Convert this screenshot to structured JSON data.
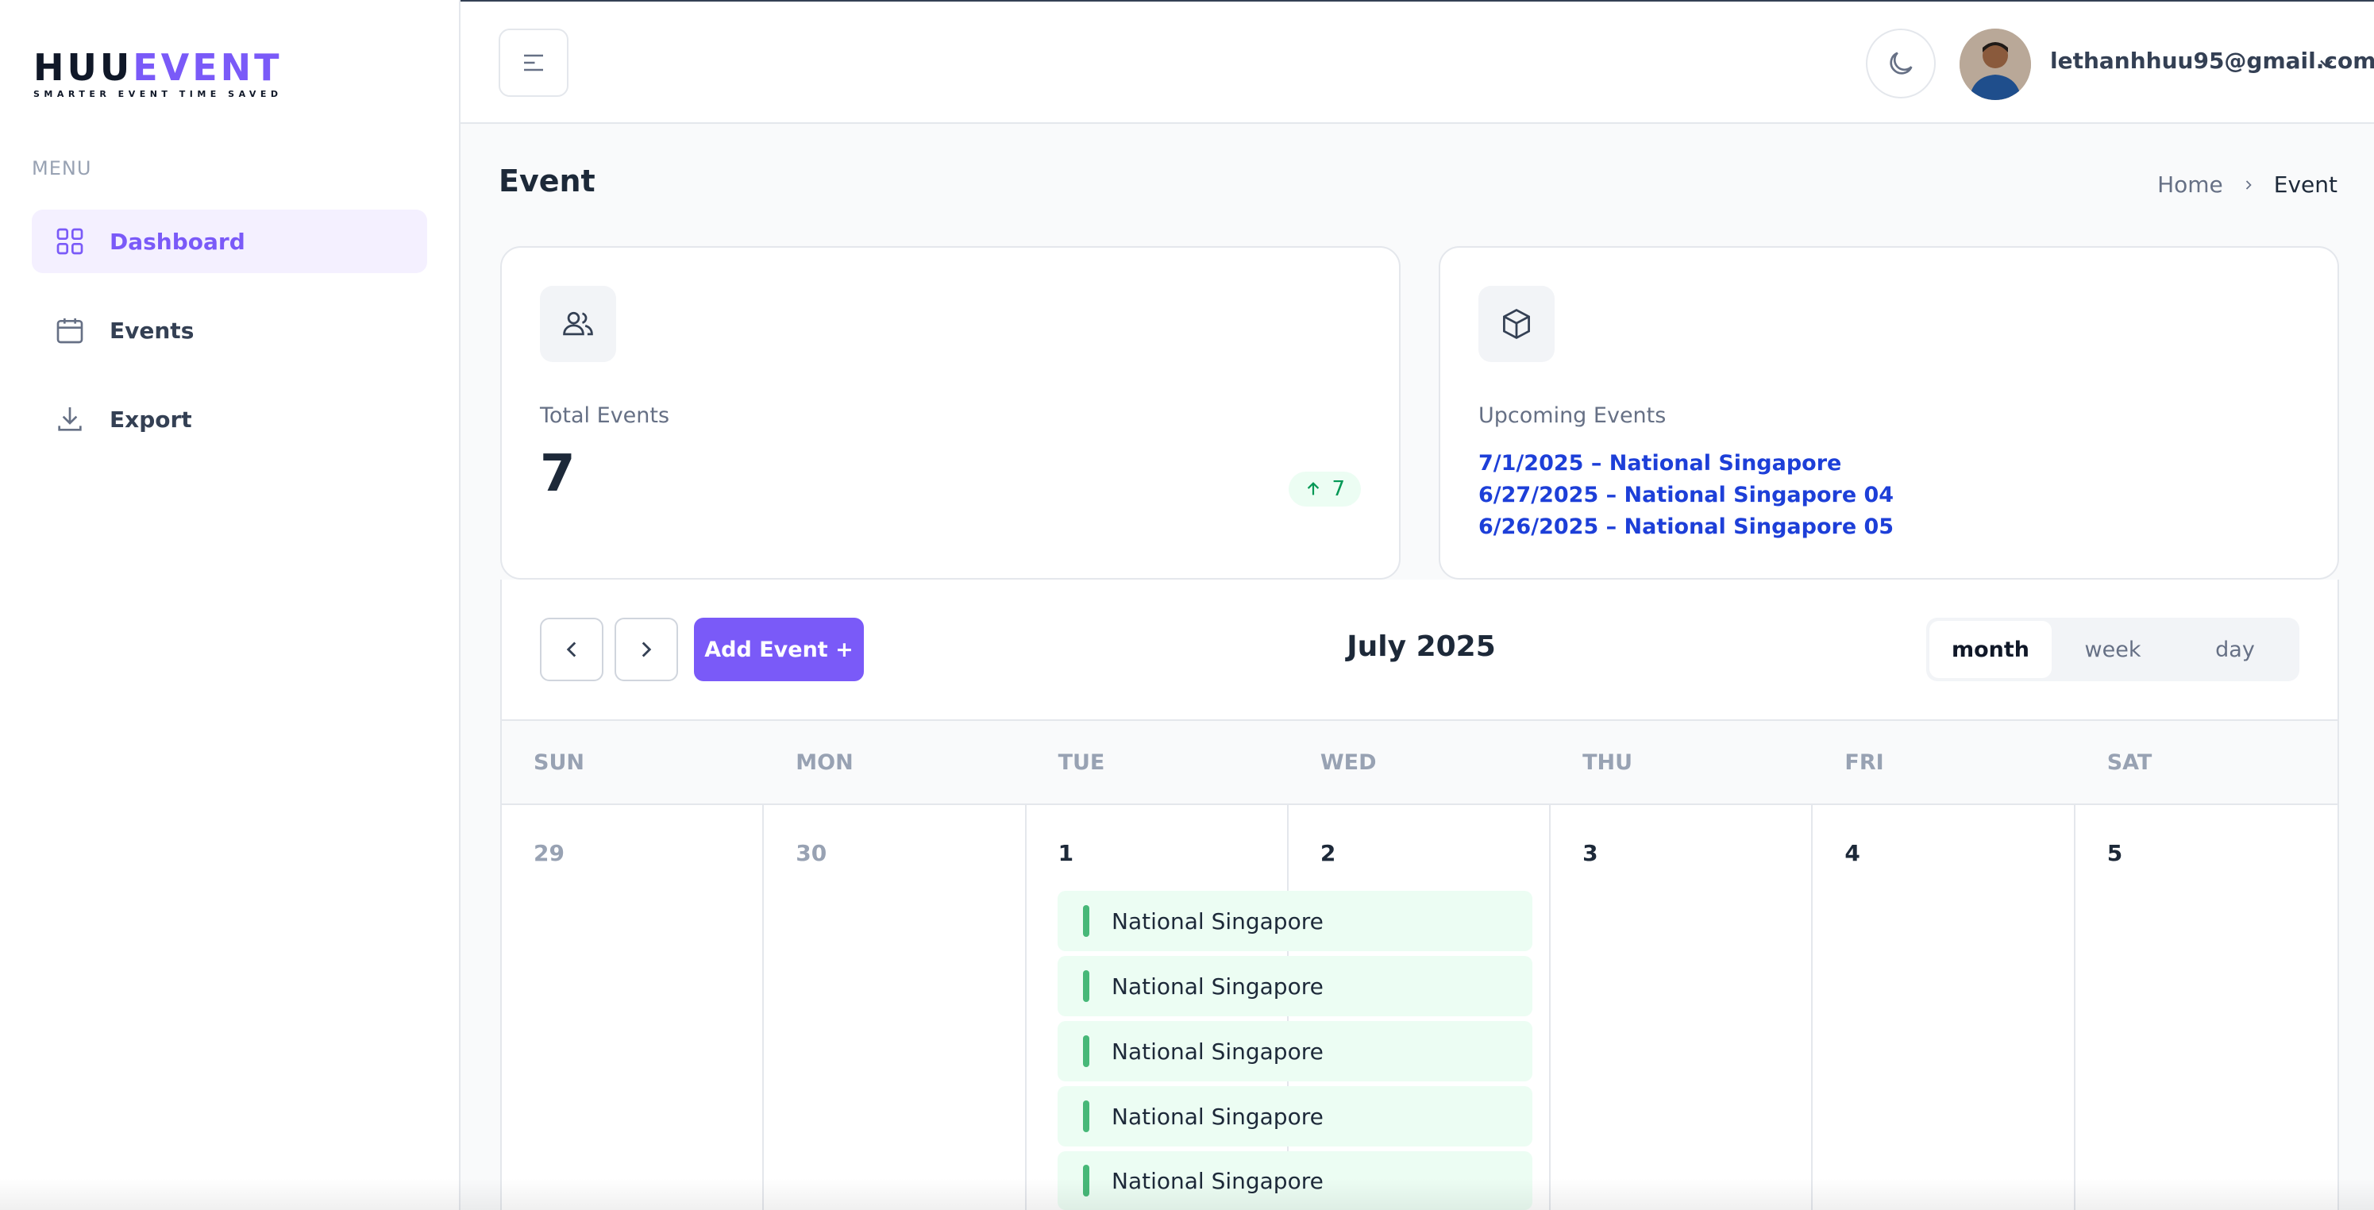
{
  "brand": {
    "logo_part1": "HUU",
    "logo_part2": "EVENT",
    "tagline": "SMARTER EVENT TIME SAVED"
  },
  "sidebar": {
    "menu_label": "MENU",
    "items": [
      {
        "label": "Dashboard",
        "icon": "grid-icon",
        "active": true
      },
      {
        "label": "Events",
        "icon": "calendar-icon",
        "active": false
      },
      {
        "label": "Export",
        "icon": "download-icon",
        "active": false
      }
    ]
  },
  "header": {
    "user_email": "lethanhhuu95@gmail.com"
  },
  "page": {
    "title": "Event",
    "breadcrumb": {
      "home": "Home",
      "current": "Event"
    }
  },
  "stats": {
    "total_events": {
      "label": "Total Events",
      "value": "7",
      "badge": "7"
    },
    "upcoming": {
      "label": "Upcoming Events",
      "items": [
        "7/1/2025 – National Singapore",
        "6/27/2025 – National Singapore 04",
        "6/26/2025 – National Singapore 05"
      ]
    }
  },
  "calendar": {
    "add_button": "Add Event +",
    "title": "July 2025",
    "views": [
      "month",
      "week",
      "day"
    ],
    "active_view": "month",
    "days_of_week": [
      "SUN",
      "MON",
      "TUE",
      "WED",
      "THU",
      "FRI",
      "SAT"
    ],
    "first_week": [
      {
        "day": "29",
        "muted": true
      },
      {
        "day": "30",
        "muted": true
      },
      {
        "day": "1",
        "muted": false
      },
      {
        "day": "2",
        "muted": false
      },
      {
        "day": "3",
        "muted": false
      },
      {
        "day": "4",
        "muted": false
      },
      {
        "day": "5",
        "muted": false
      }
    ],
    "events": [
      "National Singapore",
      "National Singapore",
      "National Singapore",
      "National Singapore",
      "National Singapore"
    ]
  },
  "colors": {
    "accent": "#7a5af8",
    "link": "#1d3fd8",
    "event_bg": "#ecfdf3",
    "event_bar": "#47b878"
  }
}
